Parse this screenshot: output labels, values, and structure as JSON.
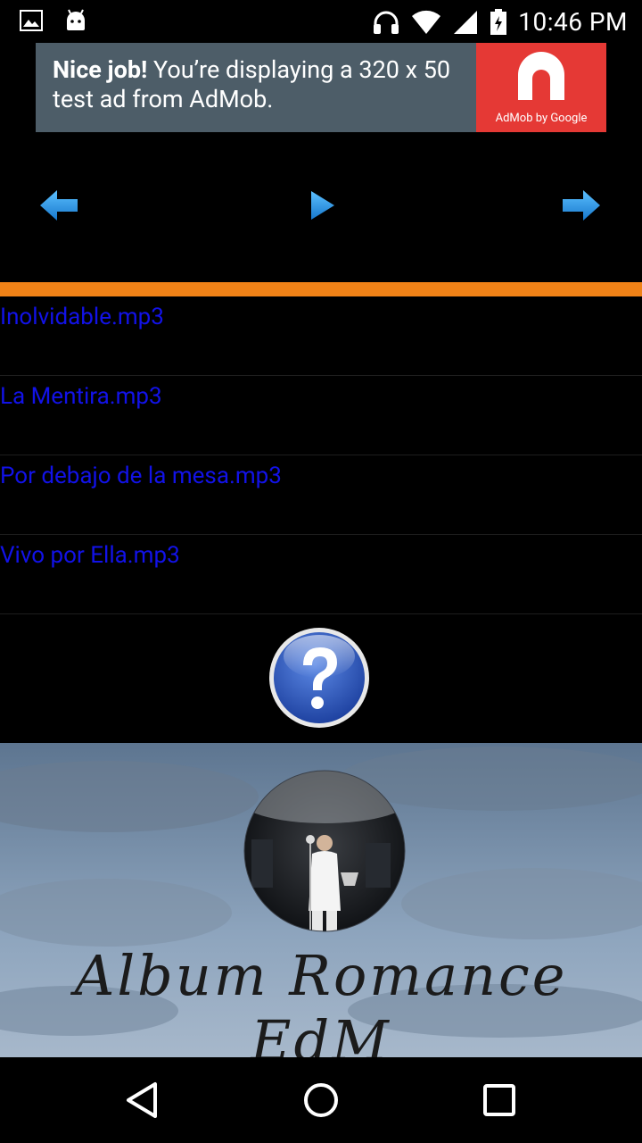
{
  "status_bar": {
    "time": "10:46 PM"
  },
  "ad": {
    "headline_bold": "Nice job!",
    "headline_rest": " You’re displaying a 320 x 50 test ad from AdMob.",
    "brand": "AdMob by Google"
  },
  "colors": {
    "accent": "#f08217",
    "song_link": "#1212e8",
    "ad_bg": "#4d5d68",
    "ad_brand": "#e53935",
    "arrow": "#1e90e8"
  },
  "controls": [
    "previous-icon",
    "play-icon",
    "next-icon"
  ],
  "songs": [
    {
      "title": "Inolvidable.mp3"
    },
    {
      "title": "La Mentira.mp3"
    },
    {
      "title": "Por debajo de la mesa.mp3"
    },
    {
      "title": "Vivo por Ella.mp3"
    }
  ],
  "cover": {
    "title": "Album Romance EdM"
  }
}
